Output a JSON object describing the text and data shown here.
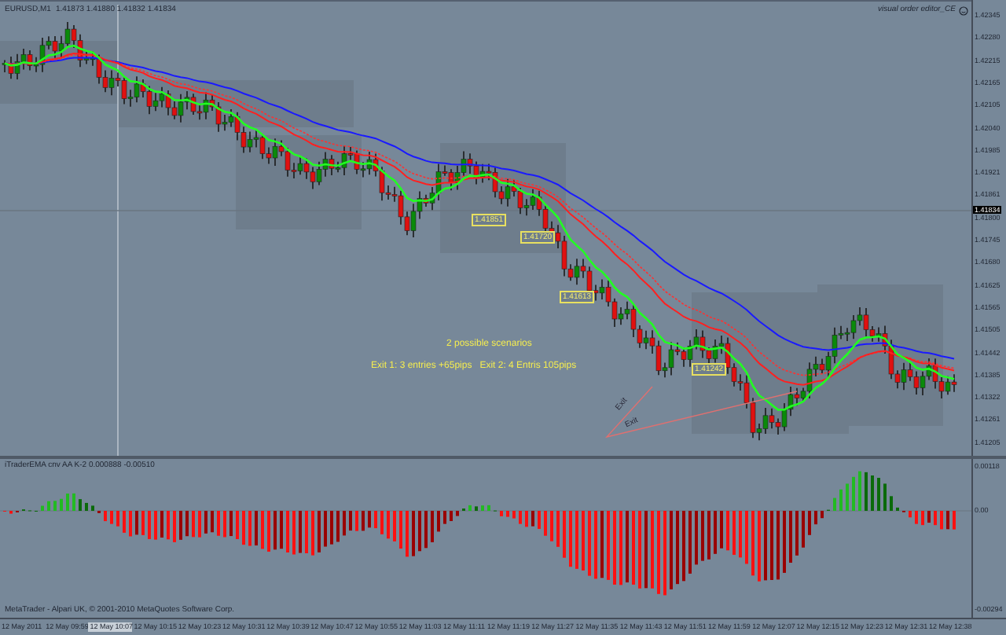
{
  "header": {
    "symbol": "EURUSD,M1",
    "quotes": "1.41873 1.41880 1.41832 1.41834"
  },
  "expert": {
    "label": "visual order editor_CE"
  },
  "price_axis": {
    "labels": [
      "1.42345",
      "1.42280",
      "1.42215",
      "1.42165",
      "1.42105",
      "1.42040",
      "1.41985",
      "1.41921",
      "1.41861",
      "1.41800",
      "1.41745",
      "1.41680",
      "1.41625",
      "1.41565",
      "1.41505",
      "1.41442",
      "1.41385",
      "1.41322",
      "1.41261",
      "1.41205"
    ],
    "current_price": "1.41834"
  },
  "annotations": {
    "price_tags": [
      "1.41851",
      "1.41720",
      "1.41613",
      "1.41242"
    ],
    "notes": [
      "2 possible scenarios",
      "Exit 1: 3 entries +65pips   Exit 2: 4 Entris 105pips"
    ],
    "exit_labels": [
      "Exit",
      "Exit"
    ]
  },
  "indicator": {
    "label": "iTraderEMA cnv AA K-2 0.000888 -0.00510",
    "axis_labels": [
      "0.00118",
      "0.00",
      "-0.00294"
    ]
  },
  "copyright": "MetaTrader - Alpari UK, © 2001-2010 MetaQuotes Software Corp.",
  "time_axis": [
    {
      "label": "12 May 2011",
      "selected": false
    },
    {
      "label": "12 May 09:59",
      "selected": false
    },
    {
      "label": "12 May 10:07",
      "selected": true
    },
    {
      "label": "12 May 10:15",
      "selected": false
    },
    {
      "label": "12 May 10:23",
      "selected": false
    },
    {
      "label": "12 May 10:31",
      "selected": false
    },
    {
      "label": "12 May 10:39",
      "selected": false
    },
    {
      "label": "12 May 10:47",
      "selected": false
    },
    {
      "label": "12 May 10:55",
      "selected": false
    },
    {
      "label": "12 May 11:03",
      "selected": false
    },
    {
      "label": "12 May 11:11",
      "selected": false
    },
    {
      "label": "12 May 11:19",
      "selected": false
    },
    {
      "label": "12 May 11:27",
      "selected": false
    },
    {
      "label": "12 May 11:35",
      "selected": false
    },
    {
      "label": "12 May 11:43",
      "selected": false
    },
    {
      "label": "12 May 11:51",
      "selected": false
    },
    {
      "label": "12 May 11:59",
      "selected": false
    },
    {
      "label": "12 May 12:07",
      "selected": false
    },
    {
      "label": "12 May 12:15",
      "selected": false
    },
    {
      "label": "12 May 12:23",
      "selected": false
    },
    {
      "label": "12 May 12:31",
      "selected": false
    },
    {
      "label": "12 May 12:38",
      "selected": false
    }
  ]
}
